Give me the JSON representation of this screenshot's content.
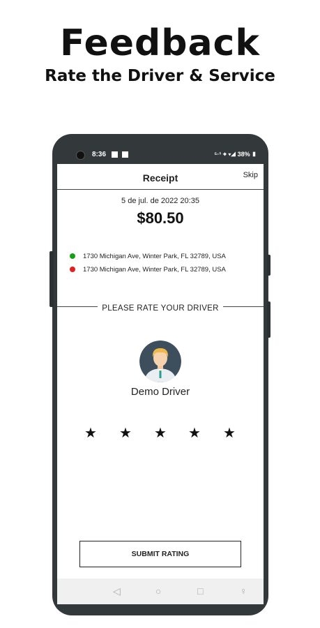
{
  "promo": {
    "title": "Feedback",
    "subtitle": "Rate the Driver & Service"
  },
  "status_bar": {
    "time": "8:36",
    "right": "⁵·¹ ⌖ ▾◢ 38% ▮"
  },
  "header": {
    "title": "Receipt",
    "skip_label": "Skip"
  },
  "receipt": {
    "date": "5 de jul. de 2022 20:35",
    "amount": "$80.50",
    "pickup": "1730 Michigan Ave, Winter Park, FL 32789, USA",
    "dropoff": "1730 Michigan Ave, Winter Park, FL 32789, USA",
    "pickup_color": "#1a9e1a",
    "dropoff_color": "#e02020"
  },
  "rating": {
    "label": "PLEASE RATE YOUR DRIVER",
    "driver_name": "Demo Driver",
    "stars": [
      "★",
      "★",
      "★",
      "★",
      "★"
    ],
    "submit_label": "SUBMIT RATING"
  },
  "nav": {
    "back": "◁",
    "home": "○",
    "recents": "□",
    "accessibility": "♀"
  },
  "icons": {
    "avatar": "driver-avatar-icon"
  }
}
